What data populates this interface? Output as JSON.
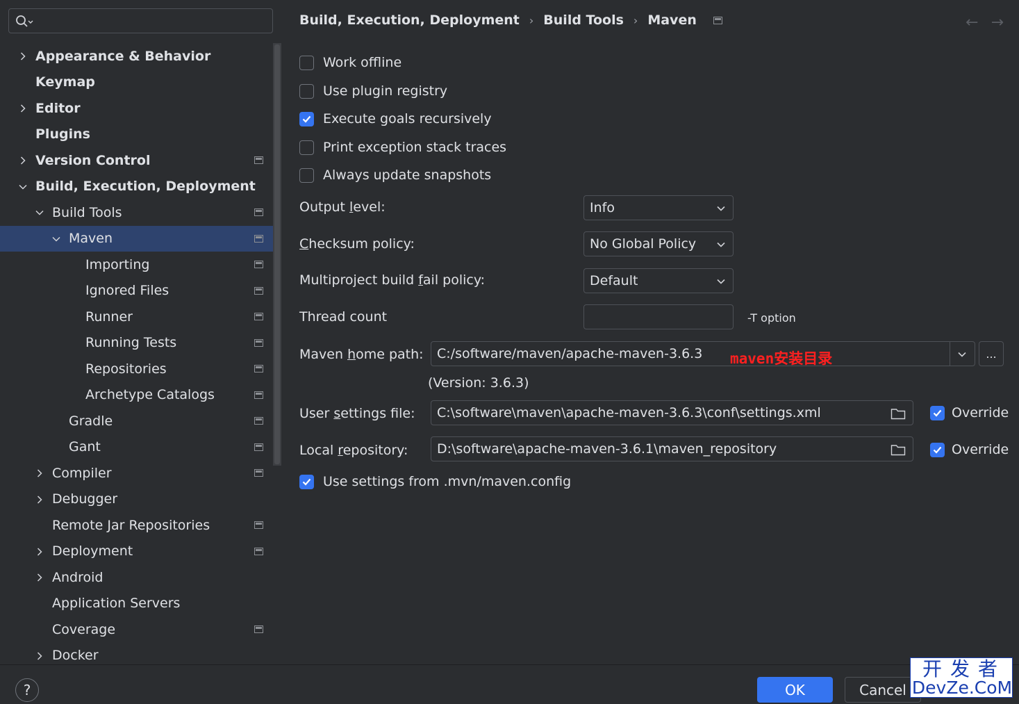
{
  "search": {
    "placeholder": ""
  },
  "sidebar": {
    "items": [
      {
        "label": "Appearance & Behavior",
        "expander": "collapsed",
        "bold": true,
        "page_icon": false,
        "depth": 0
      },
      {
        "label": "Keymap",
        "expander": "none",
        "bold": true,
        "page_icon": false,
        "depth": 0
      },
      {
        "label": "Editor",
        "expander": "collapsed",
        "bold": true,
        "page_icon": false,
        "depth": 0
      },
      {
        "label": "Plugins",
        "expander": "none",
        "bold": true,
        "page_icon": false,
        "depth": 0
      },
      {
        "label": "Version Control",
        "expander": "collapsed",
        "bold": true,
        "page_icon": true,
        "depth": 0
      },
      {
        "label": "Build, Execution, Deployment",
        "expander": "expanded",
        "bold": true,
        "page_icon": false,
        "depth": 0
      },
      {
        "label": "Build Tools",
        "expander": "expanded",
        "bold": false,
        "page_icon": true,
        "depth": 1
      },
      {
        "label": "Maven",
        "expander": "expanded",
        "bold": false,
        "page_icon": true,
        "depth": 2,
        "selected": true
      },
      {
        "label": "Importing",
        "expander": "none",
        "bold": false,
        "page_icon": true,
        "depth": 3
      },
      {
        "label": "Ignored Files",
        "expander": "none",
        "bold": false,
        "page_icon": true,
        "depth": 3
      },
      {
        "label": "Runner",
        "expander": "none",
        "bold": false,
        "page_icon": true,
        "depth": 3
      },
      {
        "label": "Running Tests",
        "expander": "none",
        "bold": false,
        "page_icon": true,
        "depth": 3
      },
      {
        "label": "Repositories",
        "expander": "none",
        "bold": false,
        "page_icon": true,
        "depth": 3
      },
      {
        "label": "Archetype Catalogs",
        "expander": "none",
        "bold": false,
        "page_icon": true,
        "depth": 3
      },
      {
        "label": "Gradle",
        "expander": "none",
        "bold": false,
        "page_icon": true,
        "depth": 2
      },
      {
        "label": "Gant",
        "expander": "none",
        "bold": false,
        "page_icon": true,
        "depth": 2
      },
      {
        "label": "Compiler",
        "expander": "collapsed",
        "bold": false,
        "page_icon": true,
        "depth": 1
      },
      {
        "label": "Debugger",
        "expander": "collapsed",
        "bold": false,
        "page_icon": false,
        "depth": 1
      },
      {
        "label": "Remote Jar Repositories",
        "expander": "none",
        "bold": false,
        "page_icon": true,
        "depth": 1
      },
      {
        "label": "Deployment",
        "expander": "collapsed",
        "bold": false,
        "page_icon": true,
        "depth": 1
      },
      {
        "label": "Android",
        "expander": "collapsed",
        "bold": false,
        "page_icon": false,
        "depth": 1
      },
      {
        "label": "Application Servers",
        "expander": "none",
        "bold": false,
        "page_icon": false,
        "depth": 1
      },
      {
        "label": "Coverage",
        "expander": "none",
        "bold": false,
        "page_icon": true,
        "depth": 1
      },
      {
        "label": "Docker",
        "expander": "collapsed",
        "bold": false,
        "page_icon": false,
        "depth": 1
      }
    ]
  },
  "breadcrumb": {
    "part1": "Build, Execution, Deployment",
    "part2": "Build Tools",
    "part3": "Maven",
    "separator": "›"
  },
  "nav": {
    "back": "←",
    "forward": "→"
  },
  "options": {
    "work_offline": {
      "label": "Work offline",
      "checked": false
    },
    "use_plugin_registry": {
      "label": "Use plugin registry",
      "checked": false
    },
    "execute_goals_recursively": {
      "label": "Execute goals recursively",
      "checked": true
    },
    "print_exception_stack_traces": {
      "label": "Print exception stack traces",
      "checked": false
    },
    "always_update_snapshots": {
      "label": "Always update snapshots",
      "checked": false
    }
  },
  "output_level": {
    "label_pre": "Output ",
    "label_u": "l",
    "label_post": "evel:",
    "value": "Info"
  },
  "checksum_policy": {
    "label_pre": "",
    "label_u": "C",
    "label_post": "hecksum policy:",
    "value": "No Global Policy"
  },
  "multiproject_fail": {
    "label_pre": "Multiproject build ",
    "label_u": "f",
    "label_post": "ail policy:",
    "value": "Default"
  },
  "thread_count": {
    "label": "Thread count",
    "value": "",
    "hint": "-T option"
  },
  "maven_home": {
    "label_pre": "Maven ",
    "label_u": "h",
    "label_post": "ome path:",
    "value": "C:/software/maven/apache-maven-3.6.3",
    "annotation": "maven安装目录",
    "version": "(Version: 3.6.3)",
    "browse": "..."
  },
  "user_settings": {
    "label_pre": "User ",
    "label_u": "s",
    "label_post": "ettings file:",
    "value": "C:\\software\\maven\\apache-maven-3.6.3\\conf\\settings.xml",
    "override_label": "Override",
    "override_checked": true
  },
  "local_repo": {
    "label_pre": "Local ",
    "label_u": "r",
    "label_post": "epository:",
    "value": "D:\\software\\apache-maven-3.6.1\\maven_repository",
    "override_label": "Override",
    "override_checked": true
  },
  "use_mvn_config": {
    "label": "Use settings from .mvn/maven.config",
    "checked": true
  },
  "footer": {
    "help": "?",
    "ok": "OK",
    "cancel": "Cancel"
  },
  "watermark": {
    "top": "开发者",
    "bottom": "DevZe.CoM"
  },
  "colors": {
    "background": "#2b2d30",
    "selection": "#2e436e",
    "accent": "#3574f0",
    "annotation": "#ff2020",
    "watermark": "#1a3fb0"
  }
}
